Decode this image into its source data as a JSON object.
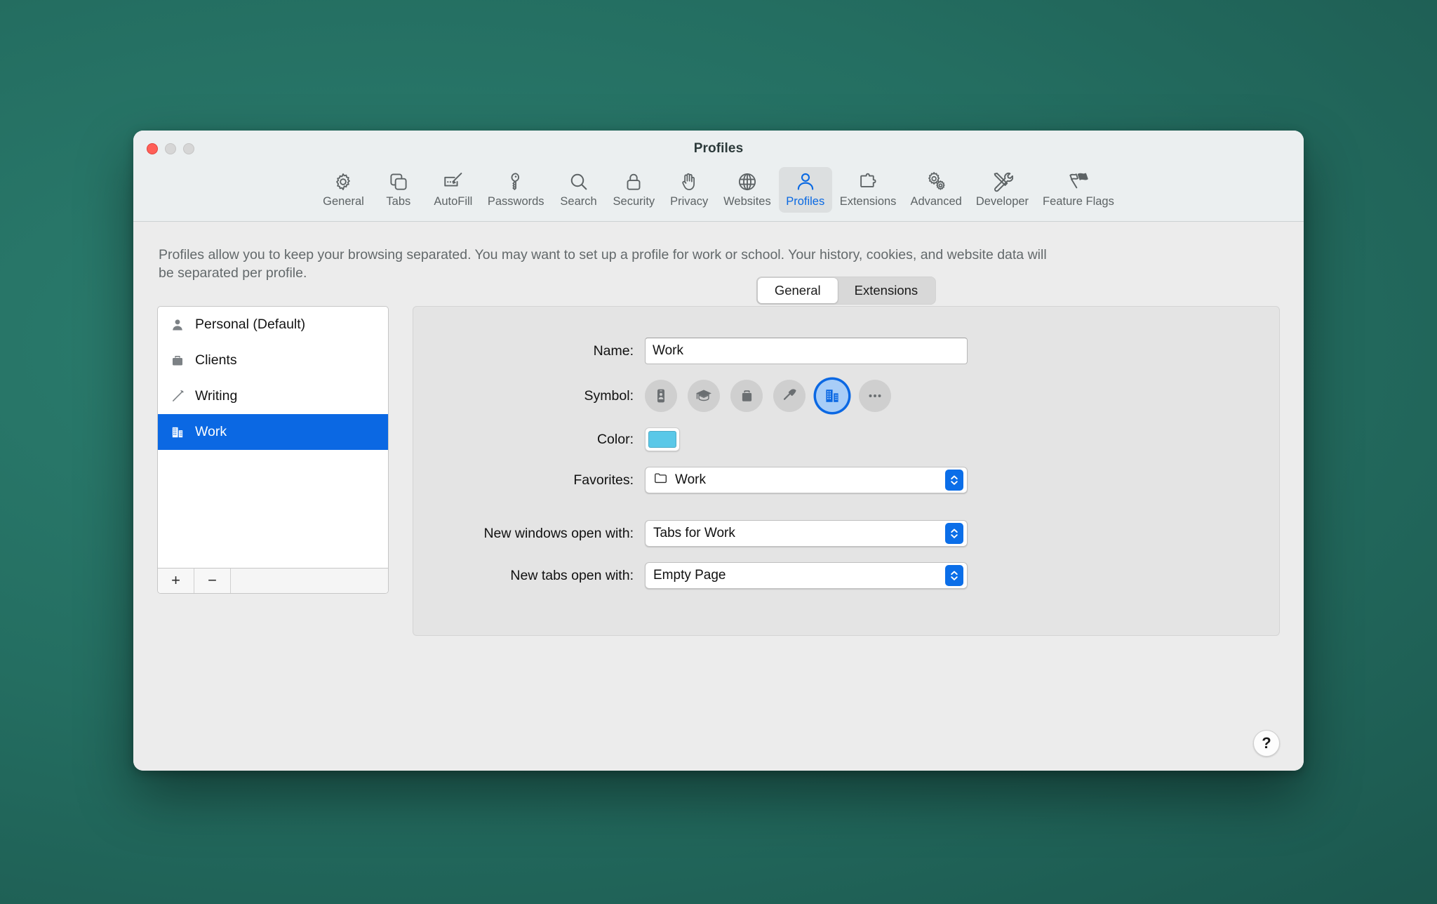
{
  "window": {
    "title": "Profiles",
    "traffic_lights": [
      "close",
      "minimize",
      "maximize"
    ]
  },
  "toolbar": {
    "items": [
      {
        "label": "General",
        "icon": "gear-icon",
        "selected": false
      },
      {
        "label": "Tabs",
        "icon": "tabs-icon",
        "selected": false
      },
      {
        "label": "AutoFill",
        "icon": "autofill-icon",
        "selected": false
      },
      {
        "label": "Passwords",
        "icon": "key-icon",
        "selected": false
      },
      {
        "label": "Search",
        "icon": "magnifier-icon",
        "selected": false
      },
      {
        "label": "Security",
        "icon": "lock-icon",
        "selected": false
      },
      {
        "label": "Privacy",
        "icon": "hand-icon",
        "selected": false
      },
      {
        "label": "Websites",
        "icon": "globe-icon",
        "selected": false
      },
      {
        "label": "Profiles",
        "icon": "person-icon",
        "selected": true
      },
      {
        "label": "Extensions",
        "icon": "puzzle-icon",
        "selected": false
      },
      {
        "label": "Advanced",
        "icon": "double-gear-icon",
        "selected": false
      },
      {
        "label": "Developer",
        "icon": "tools-icon",
        "selected": false
      },
      {
        "label": "Feature Flags",
        "icon": "flags-icon",
        "selected": false
      }
    ],
    "selected_accent": "#0a69e2"
  },
  "description": "Profiles allow you to keep your browsing separated. You may want to set up a profile for work or school. Your history, cookies, and website data will be separated per profile.",
  "profile_list": {
    "items": [
      {
        "label": "Personal (Default)",
        "icon": "person-icon",
        "selected": false
      },
      {
        "label": "Clients",
        "icon": "briefcase-icon",
        "selected": false
      },
      {
        "label": "Writing",
        "icon": "pencil-icon",
        "selected": false
      },
      {
        "label": "Work",
        "icon": "building-icon",
        "selected": true
      }
    ],
    "selection_color": "#0b68e3",
    "add_label": "+",
    "remove_label": "−"
  },
  "detail": {
    "tabs": [
      {
        "label": "General",
        "active": true
      },
      {
        "label": "Extensions",
        "active": false
      }
    ],
    "fields": {
      "name_label": "Name:",
      "name_value": "Work",
      "symbol_label": "Symbol:",
      "color_label": "Color:",
      "color_value": "#5ac8e8",
      "favorites_label": "Favorites:",
      "favorites_value": "Work",
      "new_windows_label": "New windows open with:",
      "new_windows_value": "Tabs for Work",
      "new_tabs_label": "New tabs open with:",
      "new_tabs_value": "Empty Page"
    },
    "symbols": [
      {
        "icon": "id-card-icon",
        "selected": false
      },
      {
        "icon": "graduation-cap-icon",
        "selected": false
      },
      {
        "icon": "briefcase-icon",
        "selected": false
      },
      {
        "icon": "hammer-icon",
        "selected": false
      },
      {
        "icon": "building-icon",
        "selected": true
      },
      {
        "icon": "ellipsis-icon",
        "selected": false
      }
    ]
  },
  "help": {
    "label": "?"
  }
}
